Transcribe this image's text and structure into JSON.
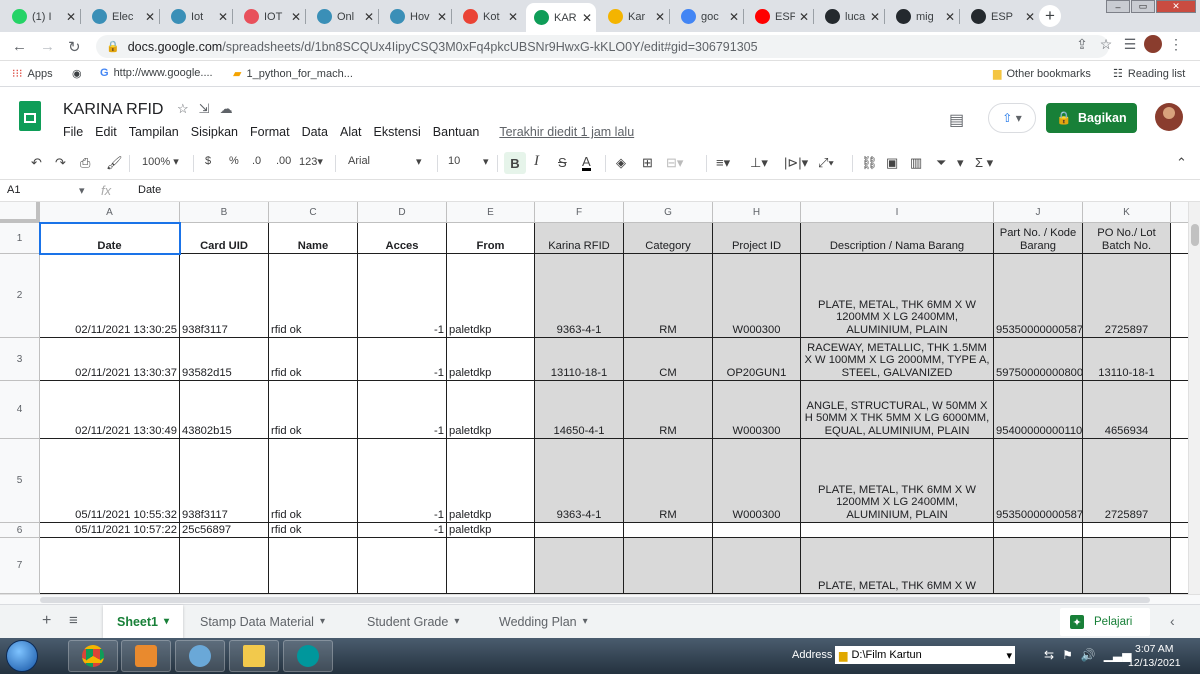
{
  "browser": {
    "tabs": [
      {
        "title": "(1) I",
        "icon": "whatsapp-icon",
        "color": "#25d366"
      },
      {
        "title": "Elec",
        "icon": "ew-icon",
        "color": "#3a8fb7"
      },
      {
        "title": "Iot",
        "icon": "ew-icon",
        "color": "#3a8fb7"
      },
      {
        "title": "IOT",
        "icon": "asterisk-icon",
        "color": "#e8505b"
      },
      {
        "title": "Onl",
        "icon": "ew-icon",
        "color": "#3a8fb7"
      },
      {
        "title": "Hov",
        "icon": "ew-icon",
        "color": "#3a8fb7"
      },
      {
        "title": "Kot",
        "icon": "gmail-icon",
        "color": "#ea4335"
      },
      {
        "title": "KAR",
        "icon": "sheets-icon",
        "color": "#0f9d58"
      },
      {
        "title": "Kar",
        "icon": "pinwheel-icon",
        "color": "#f4b400"
      },
      {
        "title": "goc",
        "icon": "google-icon",
        "color": "#4285f4"
      },
      {
        "title": "ESP",
        "icon": "youtube-icon",
        "color": "#ff0000"
      },
      {
        "title": "luca",
        "icon": "github-icon",
        "color": "#24292e"
      },
      {
        "title": "mig",
        "icon": "github-icon",
        "color": "#24292e"
      },
      {
        "title": "ESP",
        "icon": "github-icon",
        "color": "#24292e"
      }
    ],
    "url_host": "docs.google.com",
    "url_path": "/spreadsheets/d/1bn8SCQUx4IipyCSQ3M0xFq4pkcUBSNr9HwxG-kKLO0Y/edit#gid=306791305",
    "bookmarks": {
      "apps": "Apps",
      "google": "http://www.google....",
      "python": "1_python_for_mach...",
      "other": "Other bookmarks",
      "reading": "Reading list"
    }
  },
  "sheets": {
    "title": "KARINA RFID",
    "menu": [
      "File",
      "Edit",
      "Tampilan",
      "Sisipkan",
      "Format",
      "Data",
      "Alat",
      "Ekstensi",
      "Bantuan"
    ],
    "last_edit": "Terakhir diedit 1 jam lalu",
    "share_label": "Bagikan",
    "accent": "#188038"
  },
  "toolbar": {
    "zoom": "100%",
    "currency": "$",
    "percent": "%",
    "dec_less": ".0",
    "dec_more": ".00",
    "more_formats": "123",
    "font": "Arial",
    "font_size": "10",
    "bold": "B",
    "italic": "I",
    "strike": "S",
    "text_color": "A",
    "sum": "Σ"
  },
  "formula": {
    "cell": "A1",
    "value": "Date"
  },
  "columns": [
    "A",
    "B",
    "C",
    "D",
    "E",
    "F",
    "G",
    "H",
    "I",
    "J",
    "K"
  ],
  "headers": [
    "Date",
    "Card UID",
    "Name",
    "Acces",
    "From",
    "Karina RFID",
    "Category",
    "Project ID",
    "Description / Nama Barang",
    "Part No. / Kode Barang",
    "PO No./ Lot Batch No."
  ],
  "rows": [
    {
      "num": "1"
    },
    {
      "num": "2",
      "cells": [
        "02/11/2021 13:30:25",
        "938f3117",
        "rfid ok",
        "-1",
        "paletdkp",
        "9363-4-1",
        "RM",
        "W000300",
        "PLATE, METAL, THK 6MM X W 1200MM X LG 2400MM, ALUMINIUM, PLAIN",
        "95350000000587",
        "2725897"
      ]
    },
    {
      "num": "3",
      "cells": [
        "02/11/2021 13:30:37",
        "93582d15",
        "rfid ok",
        "-1",
        "paletdkp",
        "13110-18-1",
        "CM",
        "OP20GUN1",
        "RACEWAY, METALLIC, THK 1.5MM X W 100MM X LG 2000MM, TYPE A, STEEL, GALVANIZED",
        "59750000000800",
        "13110-18-1"
      ]
    },
    {
      "num": "4",
      "cells": [
        "02/11/2021 13:30:49",
        "43802b15",
        "rfid ok",
        "-1",
        "paletdkp",
        "14650-4-1",
        "RM",
        "W000300",
        "ANGLE, STRUCTURAL, W 50MM X H 50MM X THK 5MM X LG 6000MM, EQUAL, ALUMINIUM, PLAIN",
        "95400000000110",
        "4656934"
      ]
    },
    {
      "num": "5",
      "cells": [
        "05/11/2021 10:55:32",
        "938f3117",
        "rfid ok",
        "-1",
        "paletdkp",
        "9363-4-1",
        "RM",
        "W000300",
        "PLATE, METAL, THK 6MM X W 1200MM X LG 2400MM, ALUMINIUM, PLAIN",
        "95350000000587",
        "2725897"
      ]
    },
    {
      "num": "6",
      "cells": [
        "05/11/2021 10:57:22",
        "25c56897",
        "rfid ok",
        "-1",
        "paletdkp",
        "",
        "",
        "",
        "",
        "",
        ""
      ]
    },
    {
      "num": "7",
      "cells": [
        "",
        "",
        "",
        "",
        "",
        "",
        "",
        "",
        "PLATE, METAL, THK 6MM X W",
        "",
        ""
      ]
    }
  ],
  "sheet_tabs": [
    "Sheet1",
    "Stamp Data Material",
    "Student Grade",
    "Wedding Plan"
  ],
  "explore_label": "Pelajari",
  "taskbar": {
    "address_label": "Address",
    "address_value": "D:\\Film Kartun",
    "time": "3:07 AM",
    "date": "12/13/2021"
  }
}
